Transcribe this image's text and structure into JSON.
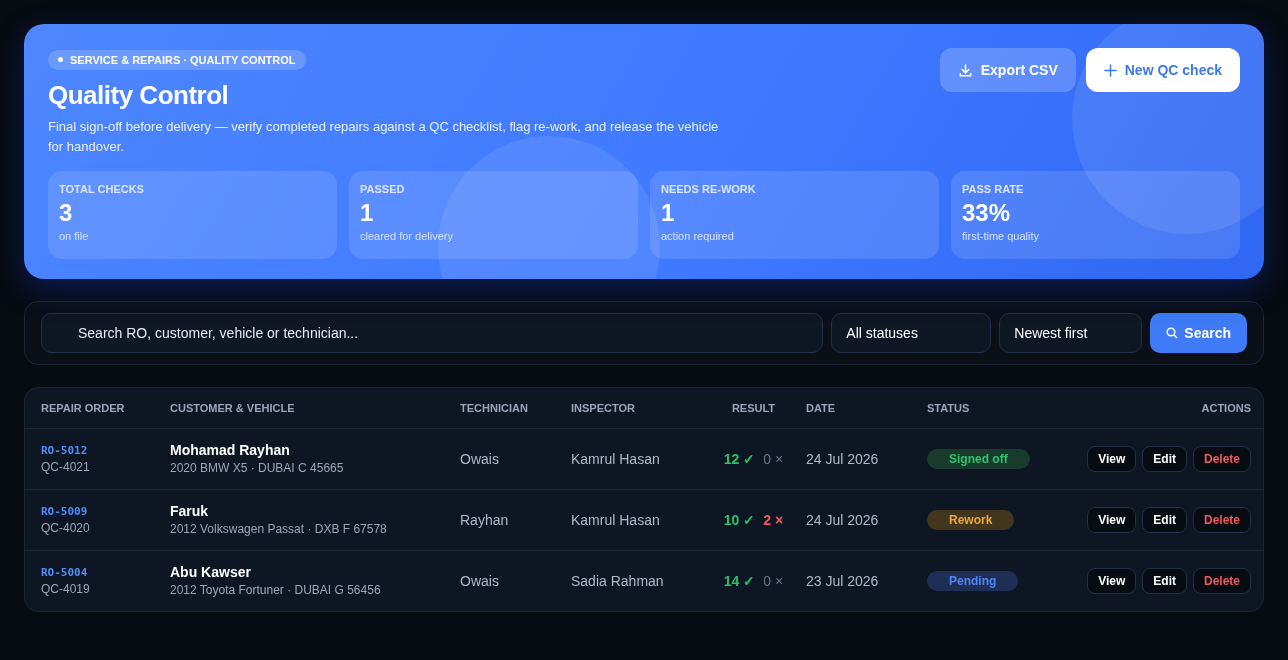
{
  "hero": {
    "breadcrumb": "SERVICE & REPAIRS · QUALITY CONTROL",
    "title": "Quality Control",
    "description": "Final sign-off before delivery — verify completed repairs against a QC checklist, flag re-work, and release the vehicle for handover.",
    "buttons": [
      {
        "label": "Export CSV",
        "kind": "secondary"
      },
      {
        "label": "New QC check",
        "kind": "primary"
      }
    ],
    "stats": [
      {
        "label": "TOTAL CHECKS",
        "value": "3",
        "note": "on file"
      },
      {
        "label": "PASSED",
        "value": "1",
        "note": "cleared for delivery"
      },
      {
        "label": "NEEDS RE-WORK",
        "value": "1",
        "note": "action required"
      },
      {
        "label": "PASS RATE",
        "value": "33%",
        "note": "first-time quality"
      }
    ]
  },
  "filters": {
    "search": {
      "placeholder": "Search RO, customer, vehicle or technician..."
    },
    "status_select": "All statuses",
    "sort_select": "Newest first",
    "search_button": "Search"
  },
  "table": {
    "columns": [
      "REPAIR ORDER",
      "CUSTOMER & VEHICLE",
      "TECHNICIAN",
      "INSPECTOR",
      "RESULT",
      "DATE",
      "STATUS",
      "ACTIONS"
    ],
    "rows": [
      {
        "ro": "RO-5012",
        "qc": "QC-4021",
        "customer": "Mohamad Rayhan",
        "vehicle": "2020 BMW X5 · DUBAI C 45665",
        "technician": "Owais",
        "inspector": "Kamrul Hasan",
        "passed": "12 ✓",
        "failed": "0 ×",
        "failed_alert": false,
        "date": "24 Jul 2026",
        "status": {
          "label": "Signed off",
          "kind": "signed_off"
        },
        "actions": [
          "View",
          "Edit",
          "Delete"
        ]
      },
      {
        "ro": "RO-5009",
        "qc": "QC-4020",
        "customer": "Faruk",
        "vehicle": "2012 Volkswagen Passat · DXB F 67578",
        "technician": "Rayhan",
        "inspector": "Kamrul Hasan",
        "passed": "10 ✓",
        "failed": "2 ×",
        "failed_alert": true,
        "date": "24 Jul 2026",
        "status": {
          "label": "Rework",
          "kind": "rework"
        },
        "actions": [
          "View",
          "Edit",
          "Delete"
        ]
      },
      {
        "ro": "RO-5004",
        "qc": "QC-4019",
        "customer": "Abu Kawser",
        "vehicle": "2012 Toyota Fortuner · DUBAI G 56456",
        "technician": "Owais",
        "inspector": "Sadia Rahman",
        "passed": "14 ✓",
        "failed": "0 ×",
        "failed_alert": false,
        "date": "23 Jul 2026",
        "status": {
          "label": "Pending",
          "kind": "pending"
        },
        "actions": [
          "View",
          "Edit",
          "Delete"
        ]
      }
    ]
  }
}
